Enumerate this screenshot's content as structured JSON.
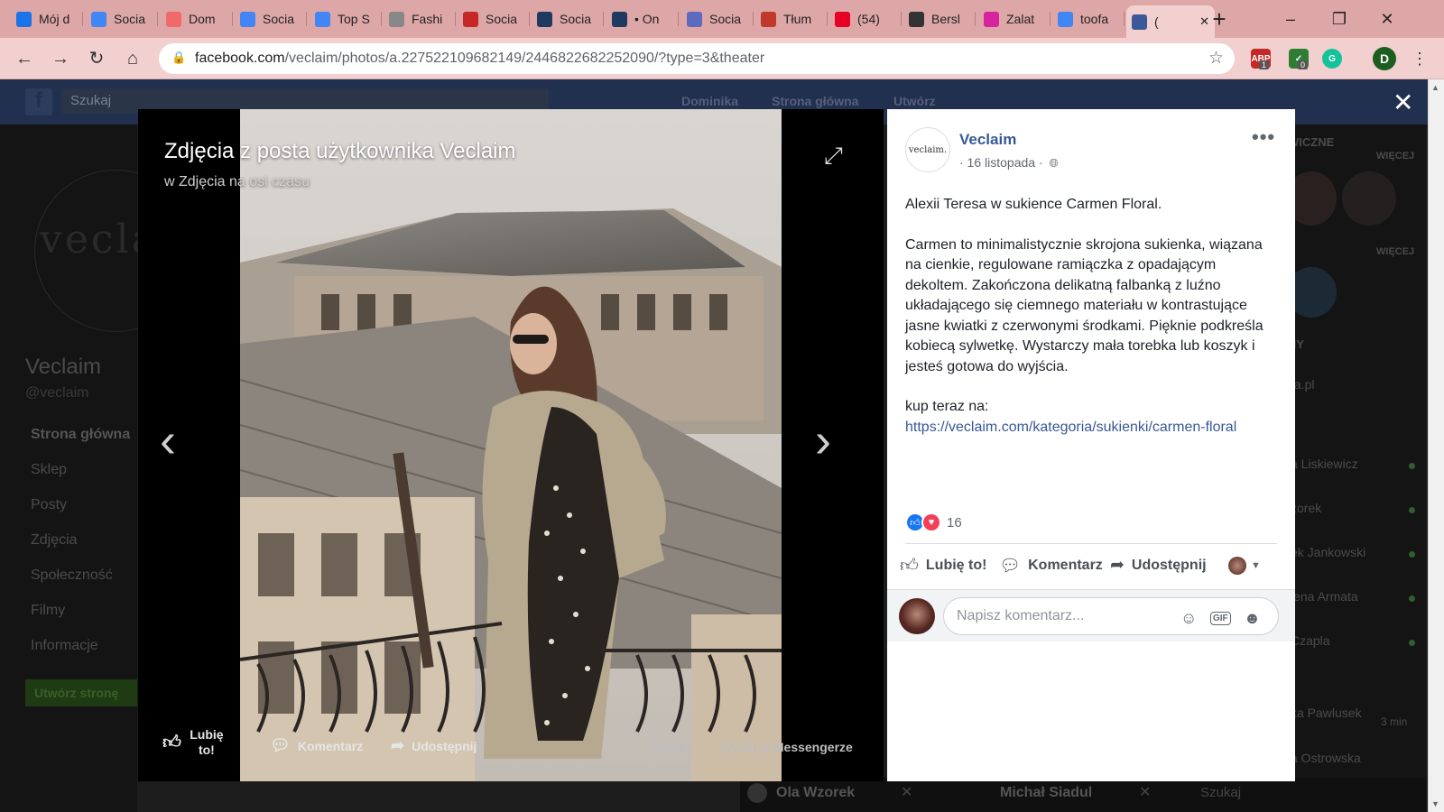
{
  "browser": {
    "tabs": [
      {
        "label": "Mój d",
        "color": "#1a73e8"
      },
      {
        "label": "Socia",
        "color": "#4285f4"
      },
      {
        "label": "Dom",
        "color": "#f06a6a"
      },
      {
        "label": "Socia",
        "color": "#4285f4"
      },
      {
        "label": "Top S",
        "color": "#4285f4"
      },
      {
        "label": "Fashi",
        "color": "#888888"
      },
      {
        "label": "Socia",
        "color": "#c62828"
      },
      {
        "label": "Socia",
        "color": "#1e3a5f"
      },
      {
        "label": "• On",
        "color": "#1e3a5f"
      },
      {
        "label": "Socia",
        "color": "#5c6bc0"
      },
      {
        "label": "Tłum",
        "color": "#c0392b"
      },
      {
        "label": "(54)",
        "color": "#e60023"
      },
      {
        "label": "Bersl",
        "color": "#333333"
      },
      {
        "label": "Zalat",
        "color": "#d6249f"
      },
      {
        "label": "toofa",
        "color": "#4285f4"
      },
      {
        "label": "(",
        "color": "#3b5998"
      }
    ],
    "new_tab": "+",
    "url_domain": "facebook.com",
    "url_path": "/veclaim/photos/a.227522109682149/2446822682252090/?type=3&theater",
    "extensions": {
      "abp_badge": "1",
      "check_badge": "0",
      "profile_initial": "D"
    },
    "window": {
      "minimize": "–",
      "restore": "❐",
      "close": "✕"
    }
  },
  "facebook": {
    "search_placeholder": "Szukaj",
    "nav": {
      "user": "Dominika",
      "home": "Strona główna",
      "create": "Utwórz"
    },
    "page": {
      "logo_text": "vecla",
      "name": "Veclaim",
      "handle": "@veclaim"
    },
    "left_menu": [
      "Strona główna",
      "Sklep",
      "Posty",
      "Zdjęcia",
      "Społeczność",
      "Filmy",
      "Informacje"
    ],
    "create_page_button": "Utwórz stronę",
    "right_col": {
      "labels": [
        "WICZNE",
        "WIĘCEJ",
        "WIĘCEJ",
        "NY"
      ],
      "contacts": [
        "ta.pl",
        "a Liskiewicz",
        "zorek",
        "ek Jankowski",
        "lena Armata",
        "Czapla",
        "ka Pawlusek",
        "a Ostrowska"
      ],
      "time_ago": "3 min"
    },
    "chat_bar": {
      "left_name": "Ola Wzorek",
      "right_name": "Michał Siadul",
      "search": "Szukaj"
    }
  },
  "theater": {
    "title": "Zdjęcia z posta użytkownika Veclaim",
    "subtitle": "w Zdjęcia na osi czasu",
    "actions": {
      "like": "Lubię to!",
      "comment": "Komentarz",
      "share": "Udostępnij",
      "options": "Opcje",
      "messenger": "Wyślij w Messengerze"
    }
  },
  "post": {
    "page_name": "Veclaim",
    "avatar_text": "veclaim.",
    "date": "· 16 listopada ·",
    "more": "•••",
    "paragraph1": "Alexii Teresa w sukience Carmen Floral.",
    "paragraph2": "Carmen to minimalistycznie skrojona sukienka, wiązana na cienkie, regulowane ramiączka z opadającym dekoltem. Zakończona delikatną falbanką z luźno układającego się ciemnego materiału w kontrastujące jasne kwiatki z czerwonymi środkami. Pięknie podkreśla kobiecą sylwetkę. Wystarczy mała torebka lub koszyk i jesteś gotowa do wyjścia.",
    "paragraph3": "kup teraz na:",
    "link": "https://veclaim.com/kategoria/sukienki/carmen-floral",
    "reaction_count": "16",
    "actions": {
      "like": "Lubię to!",
      "comment": "Komentarz",
      "share": "Udostępnij"
    },
    "comment_placeholder": "Napisz komentarz...",
    "comment_icons": {
      "emoji": "☺",
      "gif": "GIF",
      "sticker": "☻"
    }
  },
  "colors": {
    "tabbar": "#dea7a7",
    "addrbar": "#f2d0d0",
    "fb_blue": "#385898",
    "link": "#385898",
    "like_blue": "#1877f2",
    "love_red": "#f33e58"
  }
}
